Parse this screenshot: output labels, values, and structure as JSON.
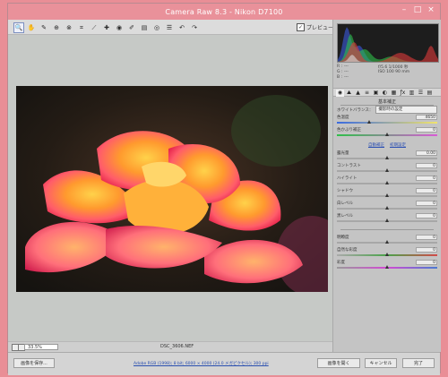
{
  "window": {
    "title": "Camera Raw 8.3  -  Nikon D7100"
  },
  "toolbar": {
    "tools": [
      "zoom-icon",
      "hand-icon",
      "white-balance-icon",
      "color-sampler-icon",
      "target-adjust-icon",
      "crop-icon",
      "straighten-icon",
      "spot-removal-icon",
      "red-eye-icon",
      "adjustment-brush-icon",
      "graduated-filter-icon",
      "radial-filter-icon",
      "preferences-icon",
      "rotate-ccw-icon",
      "rotate-cw-icon"
    ],
    "tool_glyphs": [
      "🔍",
      "✋",
      "✎",
      "⊕",
      "⊗",
      "⌗",
      "⟋",
      "✚",
      "◉",
      "✐",
      "▤",
      "◎",
      "☰",
      "↶",
      "↷"
    ],
    "preview_label": "プレビュー"
  },
  "histogram": {
    "colors": {
      "red": "#e03a3a",
      "green": "#2fbf4a",
      "blue": "#3a5ae0",
      "white": "#dddddd"
    }
  },
  "readout": {
    "r_label": "R :",
    "g_label": "G :",
    "b_label": "B :",
    "r_value": "---",
    "g_value": "---",
    "b_value": "---",
    "aperture_shutter": "f/5.6   1/1000 秒",
    "iso_focal": "ISO 100    90 mm"
  },
  "panel_tabs": [
    "◉",
    "⛰",
    "▲",
    "≡",
    "▣",
    "◐",
    "▦",
    "ƒx",
    "▥",
    "☰",
    "▤"
  ],
  "basic": {
    "title": "基本補正",
    "white_balance_label": "ホワイトバランス：",
    "white_balance_value": "撮影時の設定",
    "temperature": {
      "label": "色温度",
      "value": "4650",
      "level": 0.33
    },
    "tint": {
      "label": "色かぶり補正",
      "value": "0",
      "level": 0.5
    },
    "auto_label": "自動補正",
    "default_label": "初期設定",
    "exposure": {
      "label": "露光量",
      "value": "0.00",
      "level": 0.5
    },
    "contrast": {
      "label": "コントラスト",
      "value": "0",
      "level": 0.5
    },
    "highlights": {
      "label": "ハイライト",
      "value": "0",
      "level": 0.5
    },
    "shadows": {
      "label": "シャドウ",
      "value": "0",
      "level": 0.5
    },
    "whites": {
      "label": "白レベル",
      "value": "0",
      "level": 0.5
    },
    "blacks": {
      "label": "黒レベル",
      "value": "0",
      "level": 0.5
    },
    "clarity": {
      "label": "明瞭度",
      "value": "0",
      "level": 0.5
    },
    "vibrance": {
      "label": "自然な彩度",
      "value": "0",
      "level": 0.5
    },
    "saturation": {
      "label": "彩度",
      "value": "0",
      "level": 0.5
    }
  },
  "status": {
    "zoom": "33.5%",
    "filename": "DSC_3606.NEF"
  },
  "footer": {
    "save_button": "画像を保存...",
    "workflow_link": "Adobe RGB (1998); 8 bit; 6000 × 4000 (24.0 メガピクセル); 300 ppi",
    "open_button": "画像を開く",
    "cancel_button": "キャンセル",
    "done_button": "完了"
  }
}
